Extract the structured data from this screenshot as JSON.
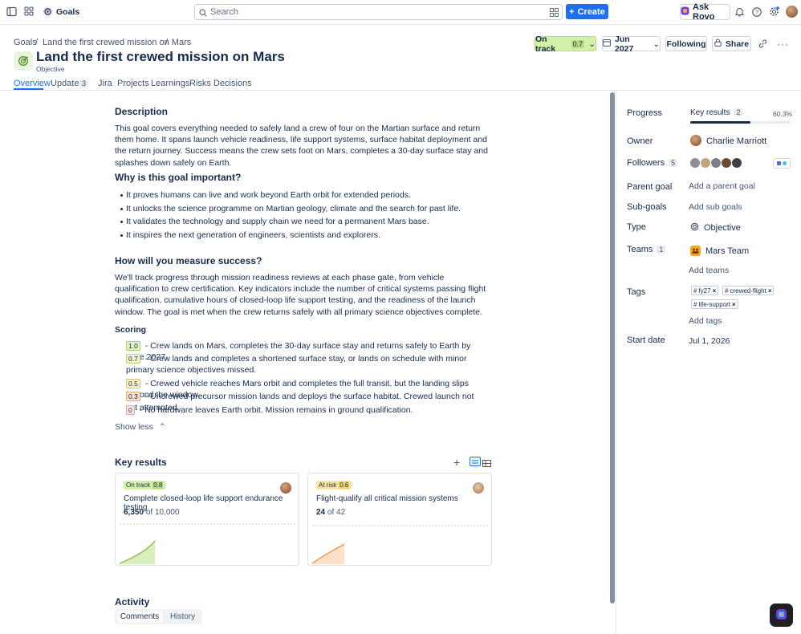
{
  "topbar": {
    "app_name": "Goals",
    "search_placeholder": "Search",
    "create_label": "Create",
    "rovo_label": "Ask Rovo"
  },
  "header": {
    "breadcrumb": [
      "Goals",
      "Land the first crewed mission on Mars"
    ],
    "title": "Land the first crewed mission on Mars",
    "subtitle": "Objective",
    "status_label": "On track",
    "status_score": "0.7",
    "date_label": "Jun 2027",
    "following_label": "Following",
    "share_label": "Share"
  },
  "tabs": [
    {
      "label": "Overview",
      "count": null
    },
    {
      "label": "Updates",
      "count": "3"
    },
    {
      "label": "Jira",
      "count": null
    },
    {
      "label": "Projects",
      "count": null
    },
    {
      "label": "Learnings",
      "count": null
    },
    {
      "label": "Risks",
      "count": null
    },
    {
      "label": "Decisions",
      "count": null
    }
  ],
  "main": {
    "description_heading": "Description",
    "description": "This goal covers everything needed to safely land a crew of four on the Martian surface and return them home. It spans launch vehicle readiness, life support systems, surface habitat deployment and the return journey. Success means the crew sets foot on Mars, completes a 30-day surface stay and splashes down safely on Earth.",
    "why_heading": "Why is this goal important?",
    "why_items": [
      "It proves humans can live and work beyond Earth orbit for extended periods.",
      "It unlocks the science programme on Martian geology, climate and the search for past life.",
      "It validates the technology and supply chain we need for a permanent Mars base.",
      "It inspires the next generation of engineers, scientists and explorers."
    ],
    "measure_heading": "How will you measure success?",
    "measure_text": "We'll track progress through mission readiness reviews at each phase gate, from vehicle qualification to crew certification. Key indicators include the number of critical systems passing flight qualification, cumulative hours of closed-loop life support testing, and the readiness of the launch window. The goal is met when the crew returns safely with all primary science objectives complete.",
    "scoring_heading": "Scoring",
    "scoring": [
      {
        "score": "1.0",
        "text": " - Crew lands on Mars, completes the 30-day surface stay and returns safely to Earth by June 2027."
      },
      {
        "score": "0.7",
        "text": " - Crew lands and completes a shortened surface stay, or lands on schedule with minor primary science objectives missed."
      },
      {
        "score": "0.5",
        "text": " - Crewed vehicle reaches Mars orbit and completes the full transit, but the landing slips beyond the window."
      },
      {
        "score": "0.3",
        "text": " - Uncrewed precursor mission lands and deploys the surface habitat. Crewed launch not yet attempted."
      },
      {
        "score": "0",
        "text": " - No hardware leaves Earth orbit. Mission remains in ground qualification."
      }
    ],
    "show_less": "Show less",
    "key_results_heading": "Key results",
    "key_results": [
      {
        "status": "On track",
        "score": "0.8",
        "title": "Complete closed-loop life support endurance testing",
        "current": "6,350",
        "of": "of",
        "target": "10,000"
      },
      {
        "status": "At risk",
        "score": "0.6",
        "title": "Flight-qualify all critical mission systems",
        "current": "24",
        "of": "of",
        "target": "42"
      }
    ],
    "activity_heading": "Activity",
    "activity_tabs": [
      "Comments",
      "History"
    ]
  },
  "sidebar": {
    "progress_label": "Progress",
    "key_results_label": "Key results",
    "key_results_count": "2",
    "progress_percent": "60.3%",
    "progress_fraction": 0.603,
    "owner_label": "Owner",
    "owner_name": "Charlie Marriott",
    "followers_label": "Followers",
    "followers_count": "5",
    "parent_goal_label": "Parent goal",
    "parent_goal_action": "Add a parent goal",
    "sub_goals_label": "Sub-goals",
    "sub_goals_action": "Add sub goals",
    "type_label": "Type",
    "type_value": "Objective",
    "teams_label": "Teams",
    "teams_count": "1",
    "team_name": "Mars Team",
    "add_teams": "Add teams",
    "tags_label": "Tags",
    "tags": [
      "fy27",
      "crewed-flight",
      "life-support"
    ],
    "add_tags": "Add tags",
    "start_date_label": "Start date",
    "start_date_value": "Jul 1, 2026"
  },
  "colors": {
    "accent": "#1d6ff2",
    "on_track": "#d3f1a7",
    "at_risk": "#f8e6a0",
    "chart_green": "#82b536",
    "chart_orange": "#f18d4b"
  }
}
